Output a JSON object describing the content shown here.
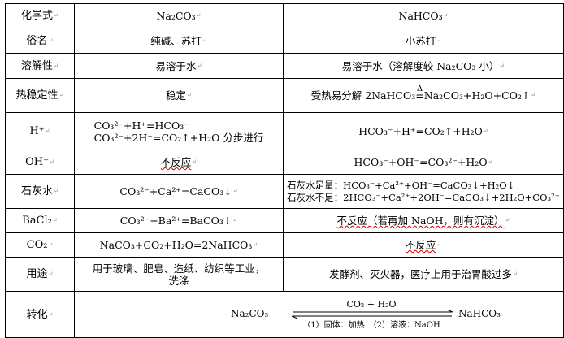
{
  "rows": [
    {
      "label": "化学式",
      "na2co3": "Na₂CO₃",
      "nahco3": "NaHCO₃"
    },
    {
      "label": "俗名",
      "na2co3": "纯碱、苏打",
      "nahco3": "小苏打"
    },
    {
      "label": "溶解性",
      "na2co3": "易溶于水",
      "nahco3": "易溶于水（溶解度较 Na₂CO₃ 小）"
    },
    {
      "label": "热稳定性",
      "na2co3": "稳定",
      "nahco3_prefix": "受热易分解 2NaHCO₃",
      "nahco3_delta": "Δ",
      "nahco3_suffix": "Na₂CO₃+H₂O+CO₂↑"
    },
    {
      "label": "H⁺",
      "na2co3_line1": "CO₃²⁻+H⁺=HCO₃⁻",
      "na2co3_line2": "CO₃²⁻+2H⁺=CO₂↑+H₂O 分步进行",
      "nahco3": "HCO₃⁻+H⁺=CO₂↑+H₂O"
    },
    {
      "label": "OH⁻",
      "na2co3": "不反应",
      "nahco3": "HCO₃⁻+OH⁻=CO₃²⁻+H₂O"
    },
    {
      "label": "石灰水",
      "na2co3": "CO₃²⁻+Ca²⁺=CaCO₃↓",
      "nahco3_line1": "石灰水足量：HCO₃⁻+Ca²⁺+OH⁻=CaCO₃↓+H₂O↓",
      "nahco3_line2": "石灰水不足：2HCO₃⁻+Ca²⁺+2OH⁻=CaCO₃↓+2H₂O+CO₃²⁻"
    },
    {
      "label": "BaCl₂",
      "na2co3": "CO₃²⁻+Ba²⁺=BaCO₃↓",
      "nahco3": "不反应（若再加 NaOH，则有沉淀）"
    },
    {
      "label": "CO₂",
      "na2co3": "NaCO₃+CO₂+H₂O=2NaHCO₃",
      "nahco3": "不反应"
    },
    {
      "label": "用途",
      "na2co3": "用于玻璃、肥皂、造纸、纺织等工业，洗涤",
      "nahco3": "发酵剂、灭火器，医疗上用于治胃酸过多"
    },
    {
      "label": "转化",
      "conv_left": "Na₂CO₃",
      "conv_right": "NaHCO₃",
      "conv_top": "CO₂ + H₂O",
      "conv_bottom": "（1）固体：加热　（2）溶液：NaOH"
    }
  ],
  "paragraph_mark": "↵"
}
